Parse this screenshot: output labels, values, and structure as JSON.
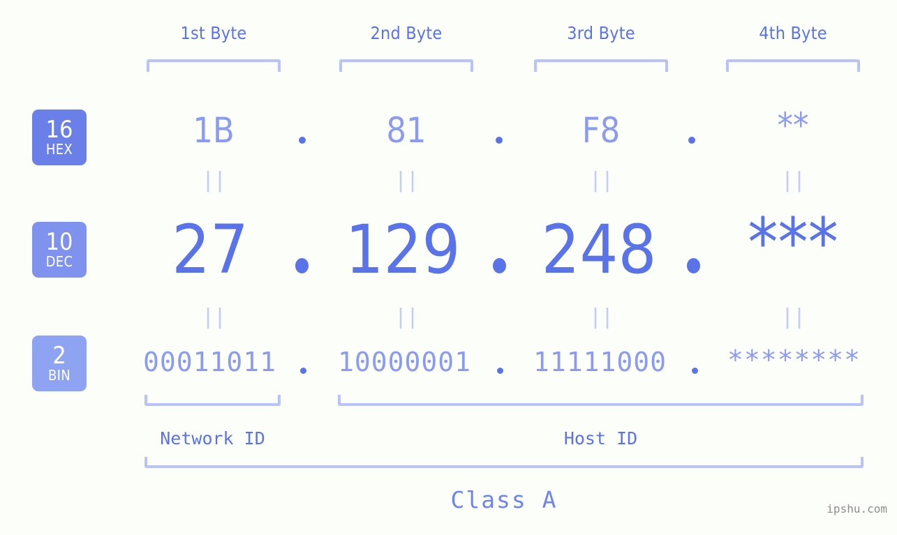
{
  "background_color": "#fcfefa",
  "accent_color": "#5b73e8",
  "accent_light_color": "#8b9bf2",
  "bracket_color": "#b9c2fb",
  "headers": {
    "byte1": "1st Byte",
    "byte2": "2nd Byte",
    "byte3": "3rd Byte",
    "byte4": "4th Byte"
  },
  "rows": {
    "hex": {
      "badge_number": "16",
      "badge_label": "HEX",
      "badge_color": "#6b7fe8",
      "values": [
        "1B",
        "81",
        "F8",
        "**"
      ],
      "separator": "."
    },
    "dec": {
      "badge_number": "10",
      "badge_label": "DEC",
      "badge_color": "#7f92ee",
      "values": [
        "27",
        "129",
        "248",
        "***"
      ],
      "separator": "."
    },
    "bin": {
      "badge_number": "2",
      "badge_label": "BIN",
      "badge_color": "#8fa3f3",
      "values": [
        "00011011",
        "10000001",
        "11111000",
        "********"
      ],
      "separator": "."
    }
  },
  "equals_mark": "||",
  "footer": {
    "network_id_label": "Network ID",
    "host_id_label": "Host ID",
    "class_label": "Class A"
  },
  "watermark": "ipshu.com"
}
